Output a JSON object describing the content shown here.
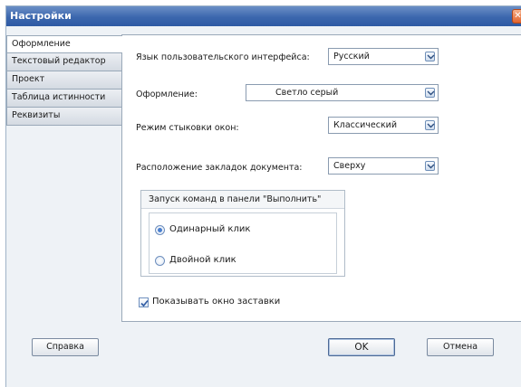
{
  "window": {
    "title": "Настройки"
  },
  "tabs": [
    {
      "label": "Оформление",
      "active": true
    },
    {
      "label": "Текстовый редактор",
      "active": false
    },
    {
      "label": "Проект",
      "active": false
    },
    {
      "label": "Таблица истинности",
      "active": false
    },
    {
      "label": "Реквизиты",
      "active": false
    }
  ],
  "settings": {
    "language": {
      "label": "Язык пользовательского интерфейса:",
      "value": "Русский"
    },
    "theme": {
      "label": "Оформление:",
      "value": "Светло серый"
    },
    "docking": {
      "label": "Режим стыковки окон:",
      "value": "Классический"
    },
    "tabs_position": {
      "label": "Расположение закладок документа:",
      "value": "Сверху"
    }
  },
  "run_group": {
    "title": "Запуск команд в панели \"Выполнить\"",
    "options": [
      {
        "label": "Одинарный клик",
        "selected": true
      },
      {
        "label": "Двойной клик",
        "selected": false
      }
    ]
  },
  "splash": {
    "label": "Показывать окно заставки",
    "checked": true
  },
  "buttons": {
    "help": "Справка",
    "ok": "OK",
    "cancel": "Отмена"
  },
  "colors": {
    "titlebar": "#3c67ae",
    "accent": "#4a7fcf",
    "close": "#e2632c"
  }
}
